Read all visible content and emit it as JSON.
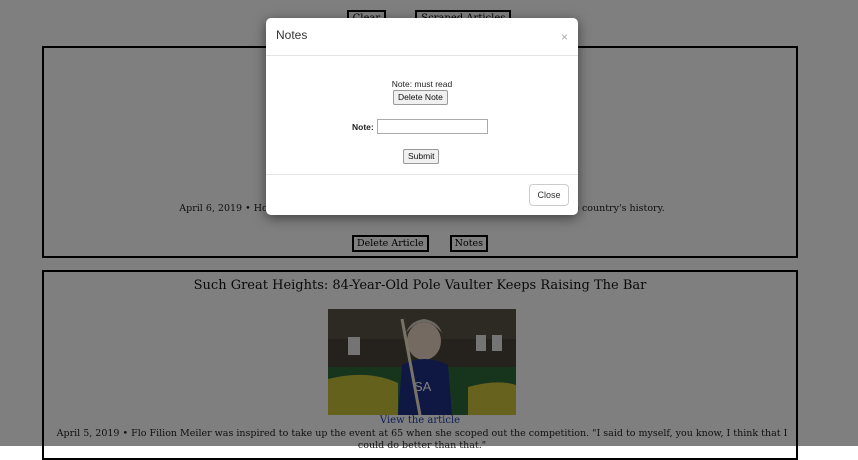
{
  "toolbar": {
    "clear_label": "Clear",
    "scraped_label": "Scraped Articles"
  },
  "articles": [
    {
      "summary": "April 6, 2019 • Hollings, who died early Saturday, ... longest-serving senator in the country's history.",
      "delete_label": "Delete Article",
      "notes_label": "Notes"
    },
    {
      "title": "Such Great Heights: 84-Year-Old Pole Vaulter Keeps Raising The Bar",
      "link_label": "View the article",
      "summary": "April 5, 2019 • Flo Filion Meiler was inspired to take up the event at 65 when she scoped out the competition. \"I said to myself, you know, I think that I could do better than that.\""
    }
  ],
  "modal": {
    "title": "Notes",
    "close_x": "×",
    "note_text": "Note: must read",
    "delete_note_label": "Delete Note",
    "note_label": "Note:",
    "note_value": "",
    "note_placeholder": "",
    "submit_label": "Submit",
    "close_label": "Close"
  }
}
